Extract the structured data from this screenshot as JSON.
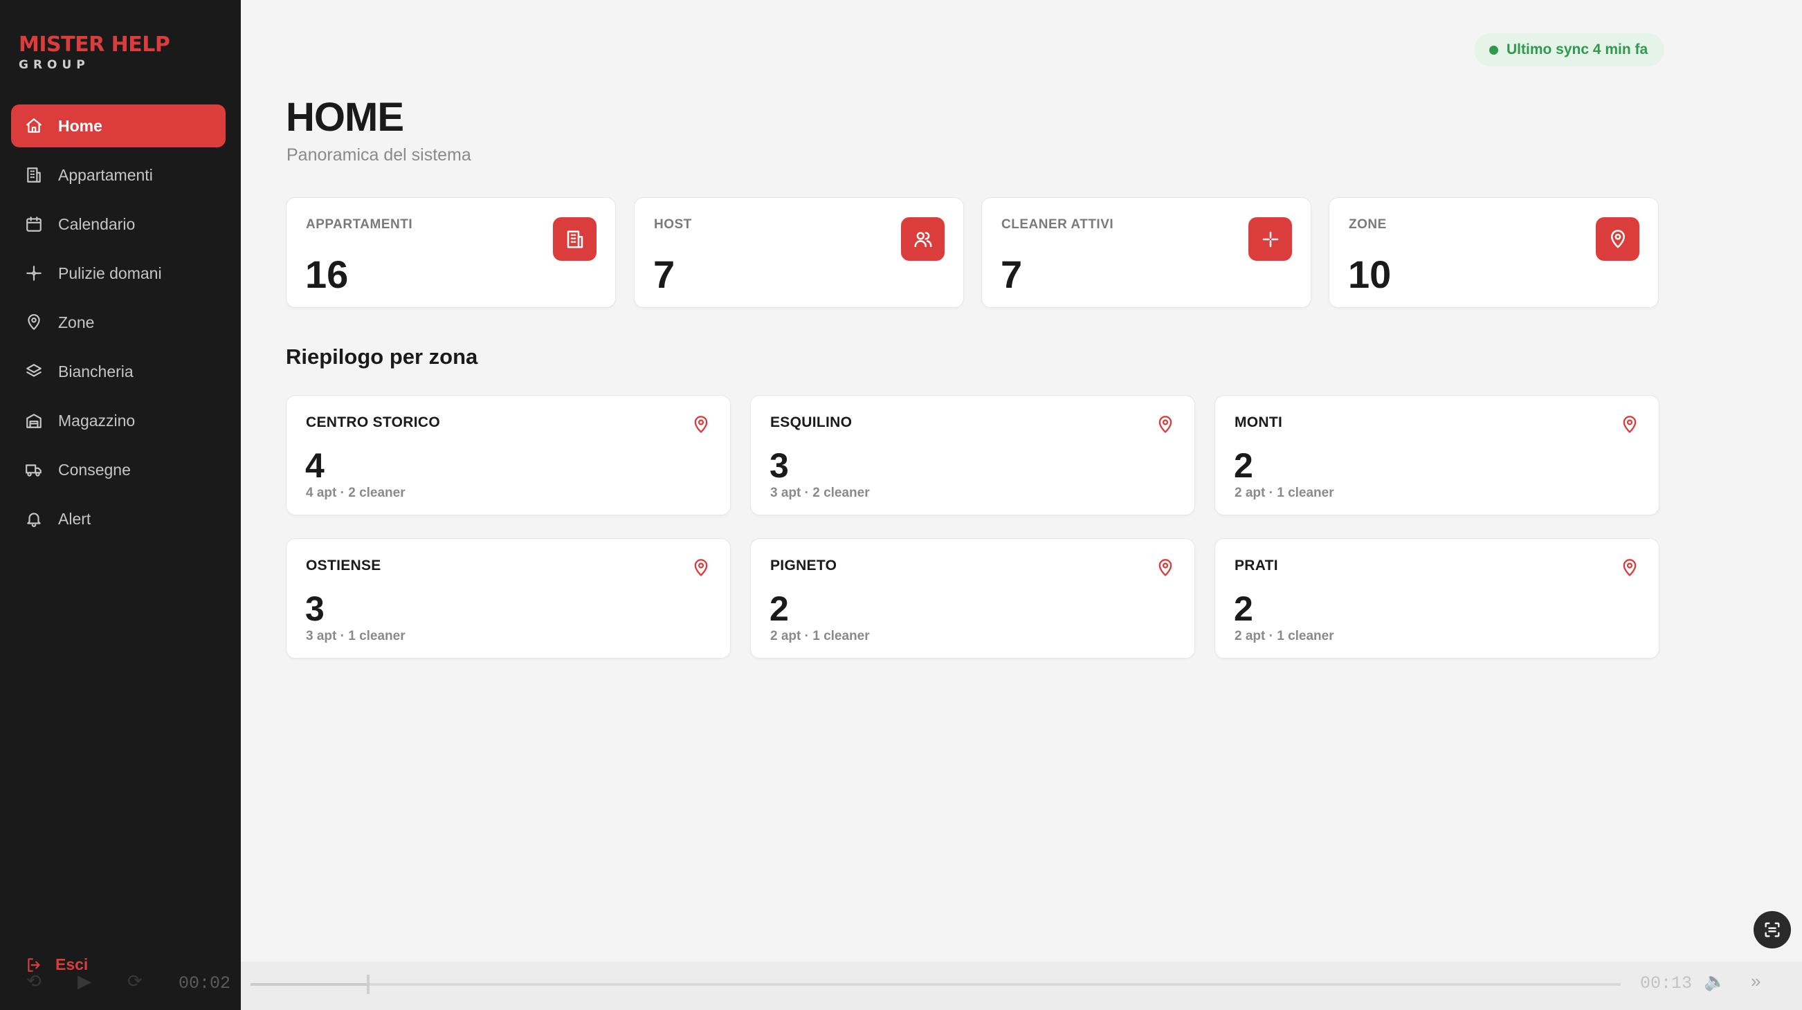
{
  "brand": {
    "name": "MISTER HELP",
    "sub": "GROUP"
  },
  "sidebar": {
    "items": [
      {
        "label": "Home",
        "icon": "home-icon",
        "active": true
      },
      {
        "label": "Appartamenti",
        "icon": "building-icon"
      },
      {
        "label": "Calendario",
        "icon": "calendar-icon"
      },
      {
        "label": "Pulizie domani",
        "icon": "sparkle-icon"
      },
      {
        "label": "Zone",
        "icon": "map-pin-icon"
      },
      {
        "label": "Biancheria",
        "icon": "layers-icon"
      },
      {
        "label": "Magazzino",
        "icon": "warehouse-icon"
      },
      {
        "label": "Consegne",
        "icon": "truck-icon"
      },
      {
        "label": "Alert",
        "icon": "bell-icon"
      }
    ],
    "logout_label": "Esci"
  },
  "sync": {
    "label": "Ultimo sync 4 min fa",
    "color": "#2f9a4d"
  },
  "header": {
    "title": "HOME",
    "subtitle": "Panoramica del sistema"
  },
  "stats": [
    {
      "label": "APPARTAMENTI",
      "value": "16",
      "icon": "building-icon"
    },
    {
      "label": "HOST",
      "value": "7",
      "icon": "users-icon"
    },
    {
      "label": "CLEANER ATTIVI",
      "value": "7",
      "icon": "sparkle-icon"
    },
    {
      "label": "ZONE",
      "value": "10",
      "icon": "map-pin-icon"
    }
  ],
  "zones_section": {
    "title": "Riepilogo per zona",
    "zones": [
      {
        "name": "CENTRO STORICO",
        "count": "4",
        "detail": "4 apt · 2 cleaner"
      },
      {
        "name": "ESQUILINO",
        "count": "3",
        "detail": "3 apt · 2 cleaner"
      },
      {
        "name": "MONTI",
        "count": "2",
        "detail": "2 apt · 1 cleaner"
      },
      {
        "name": "OSTIENSE",
        "count": "3",
        "detail": "3 apt · 1 cleaner"
      },
      {
        "name": "PIGNETO",
        "count": "2",
        "detail": "2 apt · 1 cleaner"
      },
      {
        "name": "PRATI",
        "count": "2",
        "detail": "2 apt · 1 cleaner"
      }
    ]
  },
  "media": {
    "current_time": "00:02",
    "total_time": "00:13",
    "progress": 0.085
  },
  "colors": {
    "accent": "#db3d3d",
    "sidebar_bg": "#1a1a1a",
    "page_bg": "#f4f4f4"
  }
}
